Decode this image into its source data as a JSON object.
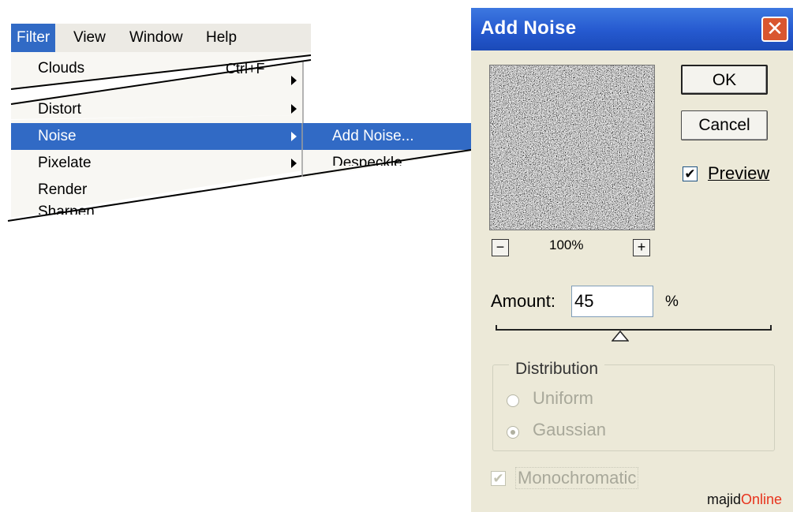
{
  "menubar": {
    "items": [
      {
        "label": "Filter",
        "active": true
      },
      {
        "label": "View"
      },
      {
        "label": "Window"
      },
      {
        "label": "Help"
      }
    ]
  },
  "filter_menu": {
    "items": [
      {
        "label": "Clouds",
        "shortcut": "Ctrl+F"
      },
      {
        "label": "",
        "submenu": true
      },
      {
        "label": "Distort",
        "submenu": true
      },
      {
        "label": "Noise",
        "submenu": true,
        "highlighted": true
      },
      {
        "label": "Pixelate",
        "submenu": true
      },
      {
        "label": "Render"
      },
      {
        "label": "Sharpen"
      }
    ]
  },
  "noise_submenu": {
    "items": [
      {
        "label": "Add Noise...",
        "highlighted": true
      },
      {
        "label": "Despeckle"
      }
    ]
  },
  "dialog": {
    "title": "Add Noise",
    "ok_label": "OK",
    "cancel_label": "Cancel",
    "preview_label": "Preview",
    "preview_checked": true,
    "zoom_level": "100%",
    "zoom_out_label": "−",
    "zoom_in_label": "+",
    "amount_label": "Amount:",
    "amount_value": "45",
    "amount_unit": "%",
    "amount_slider_level": 0.45,
    "distribution": {
      "title": "Distribution",
      "options": [
        {
          "label": "Uniform",
          "selected": false
        },
        {
          "label": "Gaussian",
          "selected": true
        }
      ]
    },
    "monochromatic_label": "Monochromatic",
    "monochromatic_checked": true
  },
  "watermark": {
    "prefix": "majid",
    "suffix": "Online"
  },
  "colors": {
    "menu_highlight": "#316ac5",
    "titlebar": "#2559cf",
    "dialog_bg": "#ece9d8",
    "watermark_accent": "#e8331c"
  }
}
